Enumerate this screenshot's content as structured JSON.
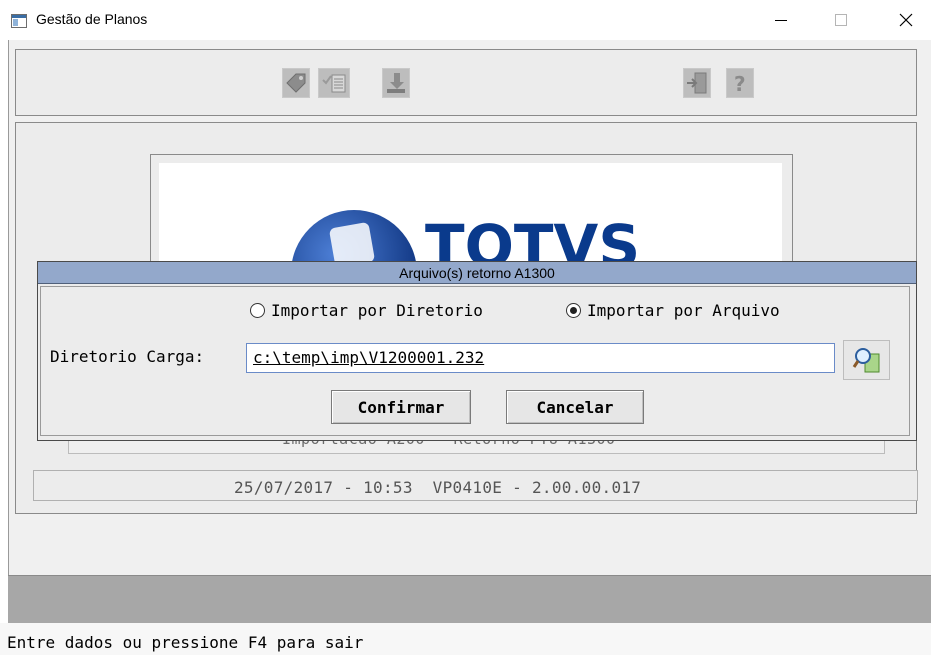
{
  "window": {
    "title": "Gestão de Planos",
    "icon": "app-window-icon",
    "controls": [
      "minimize-icon",
      "maximize-icon",
      "close-icon"
    ]
  },
  "toolbar": {
    "left_icons": [
      "tag-icon",
      "checklist-icon",
      "download-icon"
    ],
    "right_icons": [
      "exit-door-icon",
      "help-icon"
    ]
  },
  "main": {
    "logo_text": "TOTVS",
    "logo_caption": "Importacao A200 - Retorno PTU A1300",
    "status_line": "25/07/2017 - 10:53  VP0410E - 2.00.00.017"
  },
  "dialog": {
    "title": "Arquivo(s) retorno A1300",
    "radio_options": [
      {
        "label": "Importar por Diretorio",
        "selected": false
      },
      {
        "label": "Importar por Arquivo",
        "selected": true
      }
    ],
    "field_label": "Diretorio Carga:",
    "field_value": "c:\\temp\\imp\\V1200001.232",
    "confirm_label": "Confirmar",
    "cancel_label": "Cancelar",
    "search_icon": "magnifier-folder-icon"
  },
  "footer": {
    "message": "Entre dados ou pressione F4 para sair"
  },
  "colors": {
    "dialog_title_bg": "#93a8cb",
    "logo_blue": "#0a3a8c",
    "bottom_band": "#a7a7a7"
  }
}
